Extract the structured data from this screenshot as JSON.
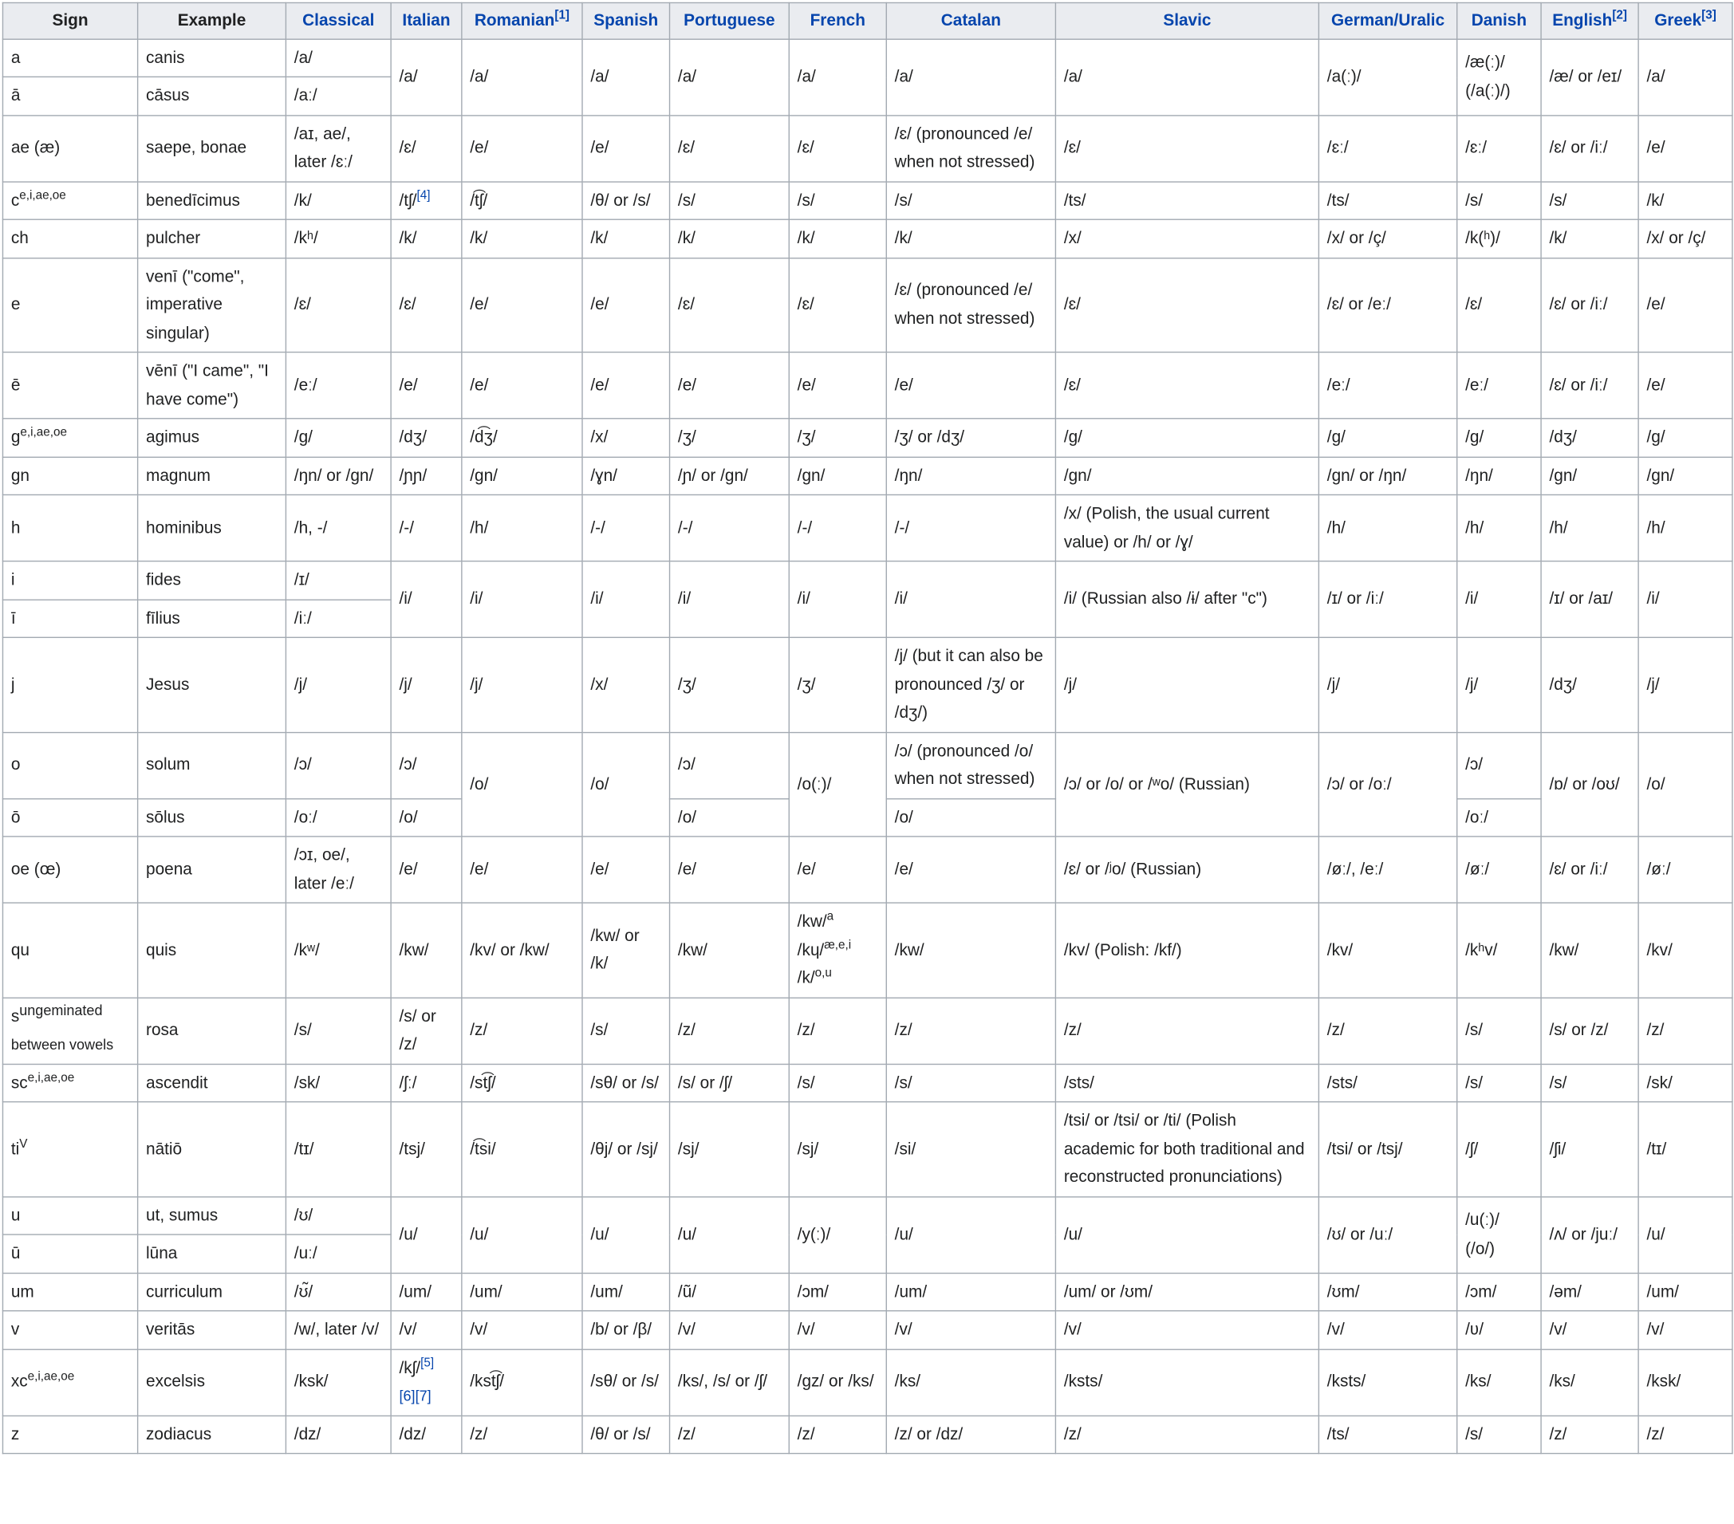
{
  "headers": [
    {
      "label": "Sign",
      "link": false
    },
    {
      "label": "Example",
      "link": false
    },
    {
      "label": "Classical",
      "link": true
    },
    {
      "label": "Italian",
      "link": true
    },
    {
      "label": "Romanian",
      "link": true,
      "ref": "[1]"
    },
    {
      "label": "Spanish",
      "link": true
    },
    {
      "label": "Portuguese",
      "link": true
    },
    {
      "label": "French",
      "link": true
    },
    {
      "label": "Catalan",
      "link": true
    },
    {
      "label": "Slavic",
      "link": true
    },
    {
      "label": "German/Uralic",
      "link": true
    },
    {
      "label": "Danish",
      "link": true
    },
    {
      "label": "English",
      "link": true,
      "ref": "[2]"
    },
    {
      "label": "Greek",
      "link": true,
      "ref": "[3]"
    }
  ],
  "rows": [
    {
      "sign": "a",
      "example": "canis",
      "classical": "/a/",
      "italian": "/a/",
      "romanian": "/a/",
      "spanish": "/a/",
      "portuguese": "/a/",
      "french": "/a/",
      "catalan": "/a/",
      "slavic": "/a/",
      "german": "/a(ː)/",
      "danish": "/æ(ː)/ (/a(ː)/)",
      "english": "/æ/ or /eɪ/",
      "greek": "/a/"
    },
    {
      "sign": "ā",
      "example": "cāsus",
      "classical": "/aː/"
    },
    {
      "sign": "ae (æ)",
      "example": "saepe, bonae",
      "classical": "/aɪ, ae/, later /ɛː/",
      "italian": "/ɛ/",
      "romanian": "/e/",
      "spanish": "/e/",
      "portuguese": "/ɛ/",
      "french": "/ɛ/",
      "catalan": "/ɛ/ (pronounced /e/ when not stressed)",
      "slavic": "/ɛ/",
      "german": "/ɛː/",
      "danish": "/ɛː/",
      "english": "/ɛ/ or /iː/",
      "greek": "/e/"
    },
    {
      "sign": "c",
      "sign_sup": "e,i,ae,oe",
      "example": "benedīcimus",
      "classical": "/k/",
      "italian": "/tʃ/",
      "italian_ref": "[4]",
      "romanian": "/t͡ʃ/",
      "spanish": "/θ/ or /s/",
      "portuguese": "/s/",
      "french": "/s/",
      "catalan": "/s/",
      "slavic": "/ts/",
      "german": "/ts/",
      "danish": "/s/",
      "english": "/s/",
      "greek": "/k/"
    },
    {
      "sign": "ch",
      "example": "pulcher",
      "classical": "/kʰ/",
      "italian": "/k/",
      "romanian": "/k/",
      "spanish": "/k/",
      "portuguese": "/k/",
      "french": "/k/",
      "catalan": "/k/",
      "slavic": "/x/",
      "german": "/x/ or /ç/",
      "danish": "/k(ʰ)/",
      "english": "/k/",
      "greek": "/x/ or /ç/"
    },
    {
      "sign": "e",
      "example": "venī (\"come\", imperative singular)",
      "classical": "/ɛ/",
      "italian": "/ɛ/",
      "romanian": "/e/",
      "spanish": "/e/",
      "portuguese": "/ɛ/",
      "french": "/ɛ/",
      "catalan": "/ɛ/ (pronounced /e/ when not stressed)",
      "slavic": "/ɛ/",
      "german": "/ɛ/ or /eː/",
      "danish": "/ɛ/",
      "english": "/ɛ/ or /iː/",
      "greek": "/e/"
    },
    {
      "sign": "ē",
      "example": "vēnī (\"I came\", \"I have come\")",
      "classical": "/eː/",
      "italian": "/e/",
      "romanian": "/e/",
      "spanish": "/e/",
      "portuguese": "/e/",
      "french": "/e/",
      "catalan": "/e/",
      "slavic": "/ɛ/",
      "german": "/eː/",
      "danish": "/eː/",
      "english": "/ɛ/ or /iː/",
      "greek": "/e/"
    },
    {
      "sign": "g",
      "sign_sup": "e,i,ae,oe",
      "example": "agimus",
      "classical": "/g/",
      "italian": "/dʒ/",
      "romanian": "/d͡ʒ/",
      "spanish": "/x/",
      "portuguese": "/ʒ/",
      "french": "/ʒ/",
      "catalan": "/ʒ/ or /dʒ/",
      "slavic": "/g/",
      "german": "/g/",
      "danish": "/g/",
      "english": "/dʒ/",
      "greek": "/g/"
    },
    {
      "sign": "gn",
      "example": "magnum",
      "classical": "/ŋn/ or /gn/",
      "italian": "/ɲɲ/",
      "romanian": "/gn/",
      "spanish": "/ɣn/",
      "portuguese": "/ɲ/ or /gn/",
      "french": "/gn/",
      "catalan": "/ŋn/",
      "slavic": "/gn/",
      "german": "/gn/ or /ŋn/",
      "danish": "/ŋn/",
      "english": "/gn/",
      "greek": "/gn/"
    },
    {
      "sign": "h",
      "example": "hominibus",
      "classical": "/h, -/",
      "italian": "/-/",
      "romanian": "/h/",
      "spanish": "/-/",
      "portuguese": "/-/",
      "french": "/-/",
      "catalan": "/-/",
      "slavic": "/x/ (Polish, the usual current value) or /h/ or /ɣ/",
      "german": "/h/",
      "danish": "/h/",
      "english": "/h/",
      "greek": "/h/"
    },
    {
      "sign": "i",
      "example": "fides",
      "classical": "/ɪ/",
      "italian": "/i/",
      "romanian": "/i/",
      "spanish": "/i/",
      "portuguese": "/i/",
      "french": "/i/",
      "catalan": "/i/",
      "slavic": "/i/ (Russian also /ɨ/ after \"c\")",
      "german": "/ɪ/ or /iː/",
      "danish": "/i/",
      "english": "/ɪ/ or /aɪ/",
      "greek": "/i/"
    },
    {
      "sign": "ī",
      "example": "fīlius",
      "classical": "/iː/"
    },
    {
      "sign": "j",
      "example": "Jesus",
      "classical": "/j/",
      "italian": "/j/",
      "romanian": "/j/",
      "spanish": "/x/",
      "portuguese": "/ʒ/",
      "french": "/ʒ/",
      "catalan": "/j/ (but it can also be pronounced /ʒ/ or /dʒ/)",
      "slavic": "/j/",
      "german": "/j/",
      "danish": "/j/",
      "english": "/dʒ/",
      "greek": "/j/"
    },
    {
      "sign": "o",
      "example": "solum",
      "classical": "/ɔ/",
      "italian": "/ɔ/",
      "romanian": "/o/",
      "spanish": "/o/",
      "portuguese": "/ɔ/",
      "french": "/o(ː)/",
      "catalan": "/ɔ/ (pronounced /o/ when not stressed)",
      "slavic": "/ɔ/ or /o/ or /ʷo/ (Russian)",
      "german": "/ɔ/ or /oː/",
      "danish": "/ɔ/",
      "english": "/ɒ/ or /oʊ/",
      "greek": "/o/"
    },
    {
      "sign": "ō",
      "example": "sōlus",
      "classical": "/oː/",
      "italian": "/o/",
      "portuguese": "/o/",
      "catalan": "/o/",
      "danish": "/oː/"
    },
    {
      "sign": "oe (œ)",
      "example": "poena",
      "classical": "/ɔɪ, oe/, later /eː/",
      "italian": "/e/",
      "romanian": "/e/",
      "spanish": "/e/",
      "portuguese": "/e/",
      "french": "/e/",
      "catalan": "/e/",
      "slavic": "/ɛ/ or /ʲo/ (Russian)",
      "german": "/øː/, /eː/",
      "danish": "/øː/",
      "english": "/ɛ/ or /iː/",
      "greek": "/øː/"
    },
    {
      "sign": "qu",
      "example": "quis",
      "classical": "/kʷ/",
      "italian": "/kw/",
      "romanian": "/kv/ or /kw/",
      "spanish": "/kw/ or /k/",
      "portuguese": "/kw/",
      "french_lines": [
        "/kw/",
        "/kɥ/",
        "/k/"
      ],
      "french_sups": [
        "a",
        "æ,e,i",
        "o,u"
      ],
      "catalan": "/kw/",
      "slavic": "/kv/ (Polish: /kf/)",
      "german": "/kv/",
      "danish": "/kʰv/",
      "english": "/kw/",
      "greek": "/kv/"
    },
    {
      "sign": "s",
      "sign_sup": "ungeminated",
      "sign_sub": "between vowels",
      "example": "rosa",
      "classical": "/s/",
      "italian": "/s/ or /z/",
      "romanian": "/z/",
      "spanish": "/s/",
      "portuguese": "/z/",
      "french": "/z/",
      "catalan": "/z/",
      "slavic": "/z/",
      "german": "/z/",
      "danish": "/s/",
      "english": "/s/ or /z/",
      "greek": "/z/"
    },
    {
      "sign": "sc",
      "sign_sup": "e,i,ae,oe",
      "example": "ascendit",
      "classical": "/sk/",
      "italian": "/ʃː/",
      "romanian": "/st͡ʃ/",
      "spanish": "/sθ/ or /s/",
      "portuguese": "/s/ or /ʃ/",
      "french": "/s/",
      "catalan": "/s/",
      "slavic": "/sts/",
      "german": "/sts/",
      "danish": "/s/",
      "english": "/s/",
      "greek": "/sk/"
    },
    {
      "sign": "ti",
      "sign_sup": "V",
      "example": "nātiō",
      "classical": "/tɪ/",
      "italian": "/tsj/",
      "romanian": "/t͡si/",
      "spanish": "/θj/ or /sj/",
      "portuguese": "/sj/",
      "french": "/sj/",
      "catalan": "/si/",
      "slavic": "/tsi/ or /tsi/ or /ti/ (Polish academic for both traditional and reconstructed pronunciations)",
      "german": "/tsi/ or /tsj/",
      "danish": "/ʃ/",
      "english": "/ʃi/",
      "greek": "/tɪ/"
    },
    {
      "sign": "u",
      "example": "ut, sumus",
      "classical": "/ʊ/",
      "italian": "/u/",
      "romanian": "/u/",
      "spanish": "/u/",
      "portuguese": "/u/",
      "french": "/y(ː)/",
      "catalan": "/u/",
      "slavic": "/u/",
      "german": "/ʊ/ or /uː/",
      "danish": "/u(ː)/ (/o/)",
      "english": "/ʌ/ or /juː/",
      "greek": "/u/"
    },
    {
      "sign": "ū",
      "example": "lūna",
      "classical": "/uː/"
    },
    {
      "sign": "um",
      "example": "curriculum",
      "classical": "/ʊ̃/",
      "italian": "/um/",
      "romanian": "/um/",
      "spanish": "/um/",
      "portuguese": "/ũ/",
      "french": "/ɔm/",
      "catalan": "/um/",
      "slavic": "/um/ or /ʊm/",
      "german": "/ʊm/",
      "danish": "/ɔm/",
      "english": "/əm/",
      "greek": "/um/"
    },
    {
      "sign": "v",
      "example": "veritās",
      "classical": "/w/, later /v/",
      "italian": "/v/",
      "romanian": "/v/",
      "spanish": "/b/ or /β/",
      "portuguese": "/v/",
      "french": "/v/",
      "catalan": "/v/",
      "slavic": "/v/",
      "german": "/v/",
      "danish": "/ʋ/",
      "english": "/v/",
      "greek": "/v/"
    },
    {
      "sign": "xc",
      "sign_sup": "e,i,ae,oe",
      "example": "excelsis",
      "classical": "/ksk/",
      "italian": "/kʃ/",
      "italian_ref": "[5]",
      "italian_ref2": "[6][7]",
      "romanian": "/kst͡ʃ/",
      "spanish": "/sθ/ or /s/",
      "portuguese": "/ks/, /s/ or /ʃ/",
      "french": "/gz/ or /ks/",
      "catalan": "/ks/",
      "slavic": "/ksts/",
      "german": "/ksts/",
      "danish": "/ks/",
      "english": "/ks/",
      "greek": "/ksk/"
    },
    {
      "sign": "z",
      "example": "zodiacus",
      "classical": "/dz/",
      "italian": "/dz/",
      "romanian": "/z/",
      "spanish": "/θ/ or /s/",
      "portuguese": "/z/",
      "french": "/z/",
      "catalan": "/z/ or /dz/",
      "slavic": "/z/",
      "german": "/ts/",
      "danish": "/s/",
      "english": "/z/",
      "greek": "/z/"
    }
  ]
}
